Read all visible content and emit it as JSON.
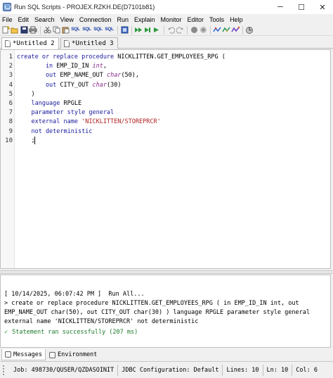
{
  "window": {
    "title": "Run SQL Scripts - PROJEX.RZKH.DE(D7101b81)",
    "minimize": "─",
    "maximize": "☐",
    "close": "✕"
  },
  "menu": [
    "File",
    "Edit",
    "Search",
    "View",
    "Connection",
    "Run",
    "Explain",
    "Monitor",
    "Editor",
    "Tools",
    "Help"
  ],
  "toolbar": {
    "icons": [
      "new-icon",
      "open-icon",
      "save-icon",
      "print-icon",
      "cut-icon",
      "copy-icon",
      "paste-icon",
      "sql-insert-icon",
      "sql-select-icon",
      "sql-update-icon",
      "sql-delete-icon",
      "connect-icon",
      "run-all-icon",
      "run-from-icon",
      "run-selected-icon",
      "undo-icon",
      "redo-icon",
      "stop-icon",
      "cancel-icon",
      "explain-icon",
      "visual-explain-icon",
      "visual-explain-all-icon",
      "monitor-icon"
    ],
    "sql_labels": [
      "SQL",
      "SQL",
      "SQL",
      "SQL"
    ]
  },
  "tabs": [
    {
      "label": "*Untitled 2",
      "active": true
    },
    {
      "label": "*Untitled 3",
      "active": false
    }
  ],
  "editor": {
    "line_numbers": [
      "1",
      "2",
      "3",
      "4",
      "5",
      "6",
      "7",
      "8",
      "9",
      "10"
    ],
    "lines": [
      [
        {
          "t": "create or replace procedure ",
          "c": "kw"
        },
        {
          "t": "NICKLITTEN.GET_EMPLOYEES_RPG (",
          "c": ""
        }
      ],
      [
        {
          "t": "        in ",
          "c": "kw"
        },
        {
          "t": "EMP_ID_IN ",
          "c": ""
        },
        {
          "t": "int",
          "c": "it"
        },
        {
          "t": ",",
          "c": ""
        }
      ],
      [
        {
          "t": "        out ",
          "c": "kw"
        },
        {
          "t": "EMP_NAME_OUT ",
          "c": ""
        },
        {
          "t": "char",
          "c": "it"
        },
        {
          "t": "(50),",
          "c": ""
        }
      ],
      [
        {
          "t": "        out ",
          "c": "kw"
        },
        {
          "t": "CITY_OUT ",
          "c": ""
        },
        {
          "t": "char",
          "c": "it"
        },
        {
          "t": "(30)",
          "c": ""
        }
      ],
      [
        {
          "t": "    )",
          "c": ""
        }
      ],
      [
        {
          "t": "    language ",
          "c": "kw"
        },
        {
          "t": "RPGLE",
          "c": ""
        }
      ],
      [
        {
          "t": "    parameter style general",
          "c": "kw"
        }
      ],
      [
        {
          "t": "    external name ",
          "c": "kw"
        },
        {
          "t": "'NICKLITTEN/STOREPRCR'",
          "c": "st"
        }
      ],
      [
        {
          "t": "    not deterministic",
          "c": "kw"
        }
      ],
      [
        {
          "t": "    ;",
          "c": ""
        }
      ]
    ]
  },
  "messages": {
    "header": "[ 10/14/2025, 06:07:42 PM ]  Run All...",
    "statement": [
      "> create or replace procedure NICKLITTEN.GET_EMPLOYEES_RPG ( in EMP_ID_IN int, out",
      "EMP_NAME_OUT char(50), out CITY_OUT char(30) ) language RPGLE parameter style general",
      "external name 'NICKLITTEN/STOREPRCR' not deterministic"
    ],
    "success": "Statement ran successfully   (207 ms)"
  },
  "bottom_tabs": [
    {
      "label": "Messages",
      "active": true
    },
    {
      "label": "Environment",
      "active": false
    }
  ],
  "status": {
    "job": "Job: 498730/QUSER/QZDASOINIT",
    "jdbc": "JDBC Configuration: Default",
    "lines": "Lines: 10",
    "ln": "Ln: 10",
    "col": "Col: 6"
  },
  "colors": {
    "keyword": "#1a1a9f",
    "type": "#8a2b8a",
    "string": "#b02020",
    "success": "#1c7a2a"
  }
}
